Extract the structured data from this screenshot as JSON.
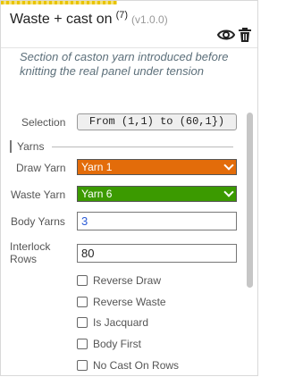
{
  "panel": {
    "title": "Waste + cast on",
    "count": "(7)",
    "version": "(v1.0.0)",
    "description": "Section of caston yarn introduced before knitting the real panel under tension",
    "icons": [
      "eye-icon",
      "trash-icon"
    ]
  },
  "selection": {
    "label": "Selection",
    "value": "From (1,1) to (60,1})"
  },
  "yarns_section": {
    "label": "Yarns"
  },
  "fields": {
    "draw_yarn": {
      "label": "Draw Yarn",
      "value": "Yarn 1",
      "color": "#e36c0a"
    },
    "waste_yarn": {
      "label": "Waste Yarn",
      "value": "Yarn 6",
      "color": "#3b9a00"
    },
    "body_yarns": {
      "label": "Body Yarns",
      "value": "3"
    },
    "interlock_rows": {
      "label": "Interlock Rows",
      "value": "80"
    }
  },
  "checkboxes": [
    {
      "label": "Reverse Draw",
      "checked": false
    },
    {
      "label": "Reverse Waste",
      "checked": false
    },
    {
      "label": "Is Jacquard",
      "checked": false
    },
    {
      "label": "Body First",
      "checked": false
    },
    {
      "label": "No Cast On Rows",
      "checked": false
    }
  ]
}
